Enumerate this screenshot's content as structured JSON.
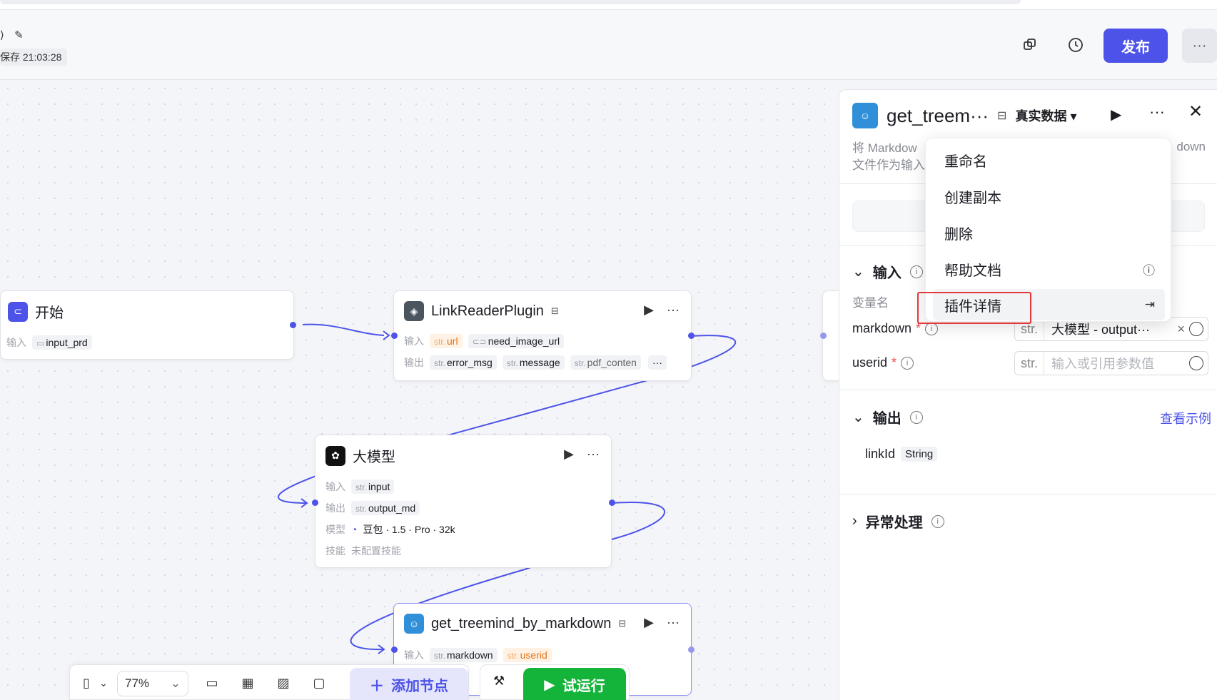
{
  "header": {
    "save_status": "保存 21:03:28",
    "publish_label": "发布",
    "more_label": "···"
  },
  "nodes": {
    "start": {
      "title": "开始",
      "input_label": "输入",
      "input_value": "input_prd"
    },
    "linkreader": {
      "title": "LinkReaderPlugin",
      "input_label": "输入",
      "inputs": [
        {
          "type": "str.",
          "name": "url"
        },
        {
          "type": "",
          "name": "need_image_url"
        }
      ],
      "output_label": "输出",
      "outputs": [
        {
          "type": "str.",
          "name": "error_msg"
        },
        {
          "type": "str.",
          "name": "message"
        },
        {
          "type": "str.",
          "name": "pdf_conten"
        }
      ],
      "overflow": "···"
    },
    "llm": {
      "title": "大模型",
      "input_label": "输入",
      "input": {
        "type": "str.",
        "name": "input"
      },
      "output_label": "输出",
      "output": {
        "type": "str.",
        "name": "output_md"
      },
      "model_label": "模型",
      "model_value": "豆包 · 1.5 · Pro · 32k",
      "skill_label": "技能",
      "skill_value": "未配置技能"
    },
    "treemind": {
      "title": "get_treemind_by_markdown",
      "input_label": "输入",
      "inputs": [
        {
          "type": "str.",
          "name": "markdown"
        },
        {
          "type": "str.",
          "name": "userid"
        }
      ]
    }
  },
  "toolbar": {
    "zoom": "77%",
    "add_node_label": "添加节点",
    "run_label": "试运行"
  },
  "panel": {
    "title": "get_treem···",
    "data_mode": "真实数据",
    "desc_line1": "将 Markdow",
    "desc_line2": "文件作为输入",
    "desc_right": "down",
    "input_section": "输入",
    "var_header": "变量名",
    "fields": [
      {
        "name": "markdown",
        "type": "str.",
        "value": "大模型 - output···"
      },
      {
        "name": "userid",
        "type": "str.",
        "placeholder": "输入或引用参数值"
      }
    ],
    "output_section": "输出",
    "view_example": "查看示例",
    "output_var": "linkId",
    "output_type": "String",
    "error_section": "异常处理"
  },
  "menu": {
    "items": [
      "重命名",
      "创建副本",
      "删除",
      "帮助文档",
      "插件详情"
    ]
  },
  "colors": {
    "primary": "#4d53e8",
    "run_green": "#14b33a",
    "highlight_red": "#e5383b"
  }
}
